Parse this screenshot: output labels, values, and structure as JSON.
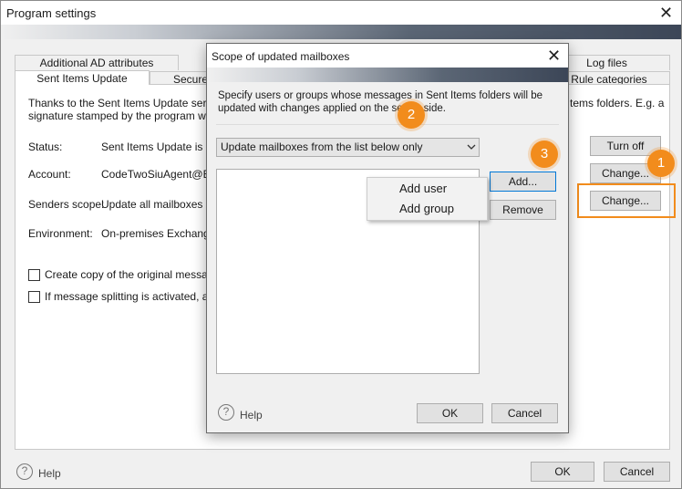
{
  "window": {
    "title": "Program settings",
    "close_glyph": "✕"
  },
  "tabs": {
    "row1": [
      "Additional AD attributes",
      "Log files"
    ],
    "row2": [
      "Sent Items Update",
      "Secure",
      "Rule categories"
    ]
  },
  "panel": {
    "intro_left_1": "Thanks to the Sent Items Update service,",
    "intro_left_2": "signature stamped by the program will be a",
    "intro_right": "tems folders. E.g. a",
    "status_label": "Status:",
    "status_value": "Sent Items Update is on",
    "account_label": "Account:",
    "account_value": "CodeTwoSiuAgent@ER.",
    "senders_label": "Senders scope:",
    "senders_value": "Update all mailboxes",
    "env_label": "Environment:",
    "env_value": "On-premises Exchange",
    "check1": "Create copy of the original message w",
    "check2": "If message splitting is activated, apply",
    "turn_off": "Turn off",
    "change1": "Change...",
    "change2": "Change..."
  },
  "footer": {
    "help_icon": "?",
    "help": "Help",
    "ok": "OK",
    "cancel": "Cancel"
  },
  "dialog": {
    "title": "Scope of updated mailboxes",
    "close_glyph": "✕",
    "description": "Specify users or groups whose messages in Sent Items folders will be updated with changes applied on the server side.",
    "select_value": "Update mailboxes from the list below only",
    "add": "Add...",
    "remove": "Remove",
    "help_icon": "?",
    "help": "Help",
    "ok": "OK",
    "cancel": "Cancel"
  },
  "context_menu": {
    "items": [
      "Add user",
      "Add group"
    ]
  },
  "badges": [
    "1",
    "2",
    "3"
  ],
  "colors": {
    "accent_orange": "#f28c1c",
    "focus_blue": "#0078d7"
  }
}
